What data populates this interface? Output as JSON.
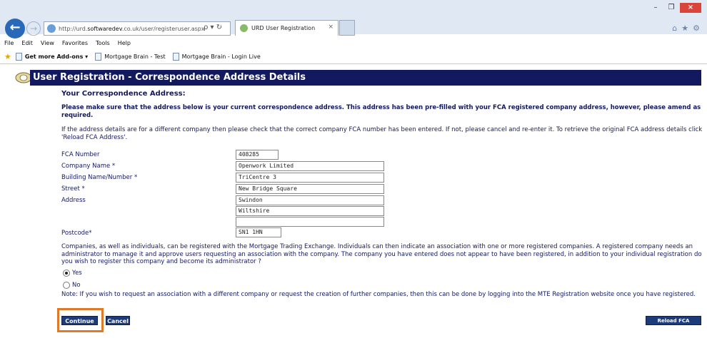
{
  "browser": {
    "url_prefix": "http://urd.",
    "url_domain": "softwaredev",
    "url_suffix": ".co.uk/user/registeruser.aspx",
    "tab_title": "URD User Registration",
    "tab_close": "×",
    "addr_icons": "ρ ▾ ↻",
    "window_min": "–",
    "window_max": "❐",
    "window_close": "×",
    "back_glyph": "←",
    "forward_glyph": "→",
    "right_icons": [
      "⌂",
      "★",
      "⚙"
    ]
  },
  "menu": [
    "File",
    "Edit",
    "View",
    "Favorites",
    "Tools",
    "Help"
  ],
  "favorites": {
    "addons": "Get more Add-ons ▾",
    "items": [
      "Mortgage Brain - Test",
      "Mortgage Brain - Login Live"
    ]
  },
  "page": {
    "header": "User Registration - Correspondence Address Details",
    "section_title": "Your Correspondence Address:",
    "intro_bold": "Please make sure that the address below is your current correspondence address. This address has been pre-filled with your FCA registered company address, however, please amend as required.",
    "intro_plain": "If the address details are for a different company then please check that the correct company FCA number has been entered. If not, please cancel and re-enter it. To retrieve the original FCA address details click 'Reload FCA Address'.",
    "form": {
      "fca_label": "FCA Number",
      "fca_value": "408285",
      "company_label": "Company Name *",
      "company_value": "Openwork Limited",
      "building_label": "Building Name/Number *",
      "building_value": "TriCentre 3",
      "street_label": "Street *",
      "street_value": "New Bridge Square",
      "address_label": "Address",
      "address_line1": "Swindon",
      "address_line2": "Wiltshire",
      "address_line3": "",
      "postcode_label": "Postcode*",
      "postcode_value": "SN1 1HN"
    },
    "company_question": "Companies, as well as individuals, can be registered with the Mortgage Trading Exchange. Individuals can then indicate an association with one or more registered companies. A registered company needs an administrator to manage it and approve users requesting an association with the company. The company you have entered does not appear to have been registered, in addition to your individual registration do you wish to register this company and become its administrator ?",
    "radio_yes": "Yes",
    "radio_no": "No",
    "selected_option": "Yes",
    "note": "Note: If you wish to request an association with a different company or request the creation of further companies, then this can be done by logging into the MTE Registration website once you have registered.",
    "buttons": {
      "continue": "Continue",
      "cancel": "Cancel",
      "reload": "Reload FCA Address"
    }
  },
  "colors": {
    "header_bg": "#13195e",
    "button_bg": "#1d3b7a",
    "highlight": "#e07a2b",
    "text": "#13195e"
  }
}
